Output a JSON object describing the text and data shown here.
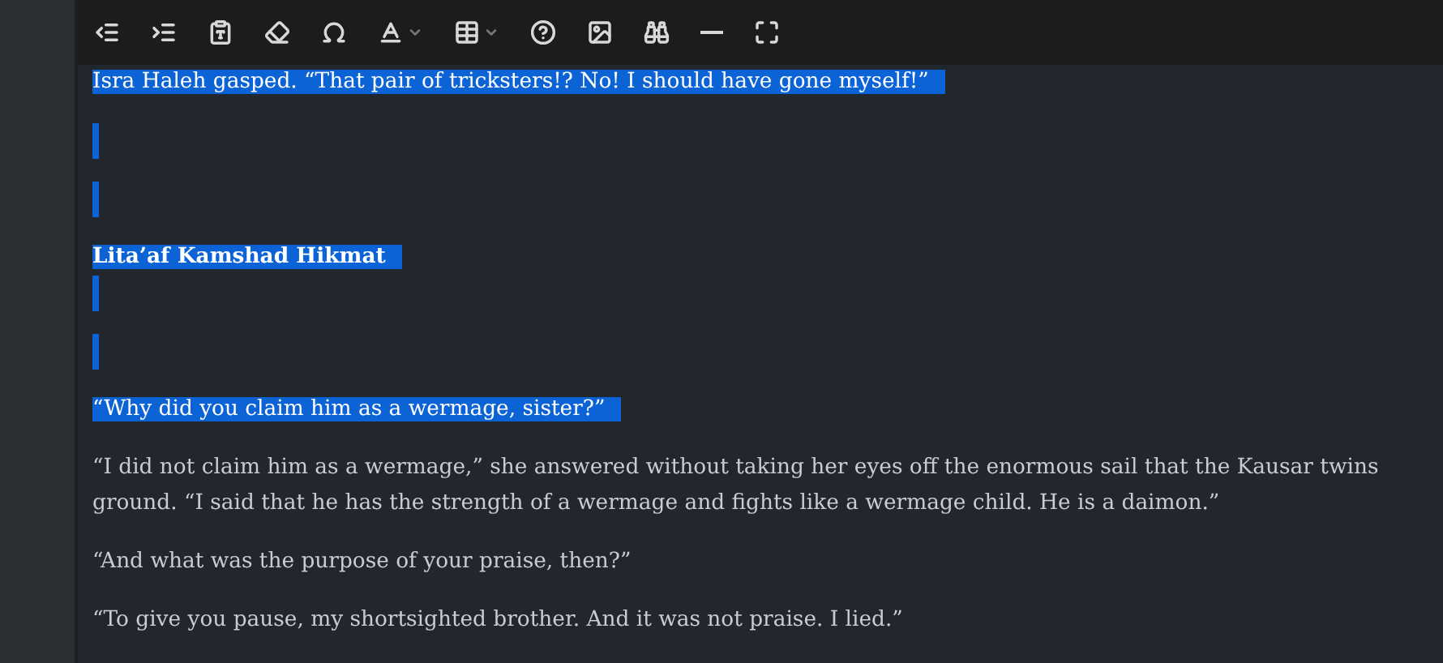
{
  "toolbar": {
    "buttons": [
      {
        "kind": "outdent"
      },
      {
        "kind": "indent"
      },
      {
        "kind": "paste-text"
      },
      {
        "kind": "eraser"
      },
      {
        "kind": "omega"
      },
      {
        "kind": "text-color",
        "dropdown": true
      },
      {
        "kind": "table",
        "dropdown": true
      },
      {
        "kind": "help"
      },
      {
        "kind": "image"
      },
      {
        "kind": "find"
      },
      {
        "kind": "rule"
      },
      {
        "kind": "maximize"
      }
    ]
  },
  "paragraphs": [
    {
      "kind": "text",
      "selected": true,
      "lines": [
        "Isra Haleh gasped. “That pair of tricksters!? No! I should have gone myself!”"
      ]
    },
    {
      "kind": "empty",
      "selected": true
    },
    {
      "kind": "empty",
      "selected": true
    },
    {
      "kind": "heading",
      "selected": true,
      "lines": [
        "Lita’af Kamshad Hikmat"
      ]
    },
    {
      "kind": "empty",
      "selected": true
    },
    {
      "kind": "empty",
      "selected": true
    },
    {
      "kind": "text",
      "selected": true,
      "lines": [
        "“Why did you claim him as a wermage, sister?”"
      ]
    },
    {
      "kind": "text",
      "selected": false,
      "lines": [
        "“I did not claim him as a wermage,” she answered without taking her eyes off the enormous sail that the Kausar twins",
        "ground. “I said that he has the strength of a wermage and fights like a wermage child. He is a daimon.”"
      ]
    },
    {
      "kind": "text",
      "selected": false,
      "lines": [
        "“And what was the purpose of your praise, then?”"
      ]
    },
    {
      "kind": "text",
      "selected": false,
      "lines": [
        "“To give you pause, my shortsighted brother. And it was not praise. I lied.”"
      ]
    }
  ]
}
